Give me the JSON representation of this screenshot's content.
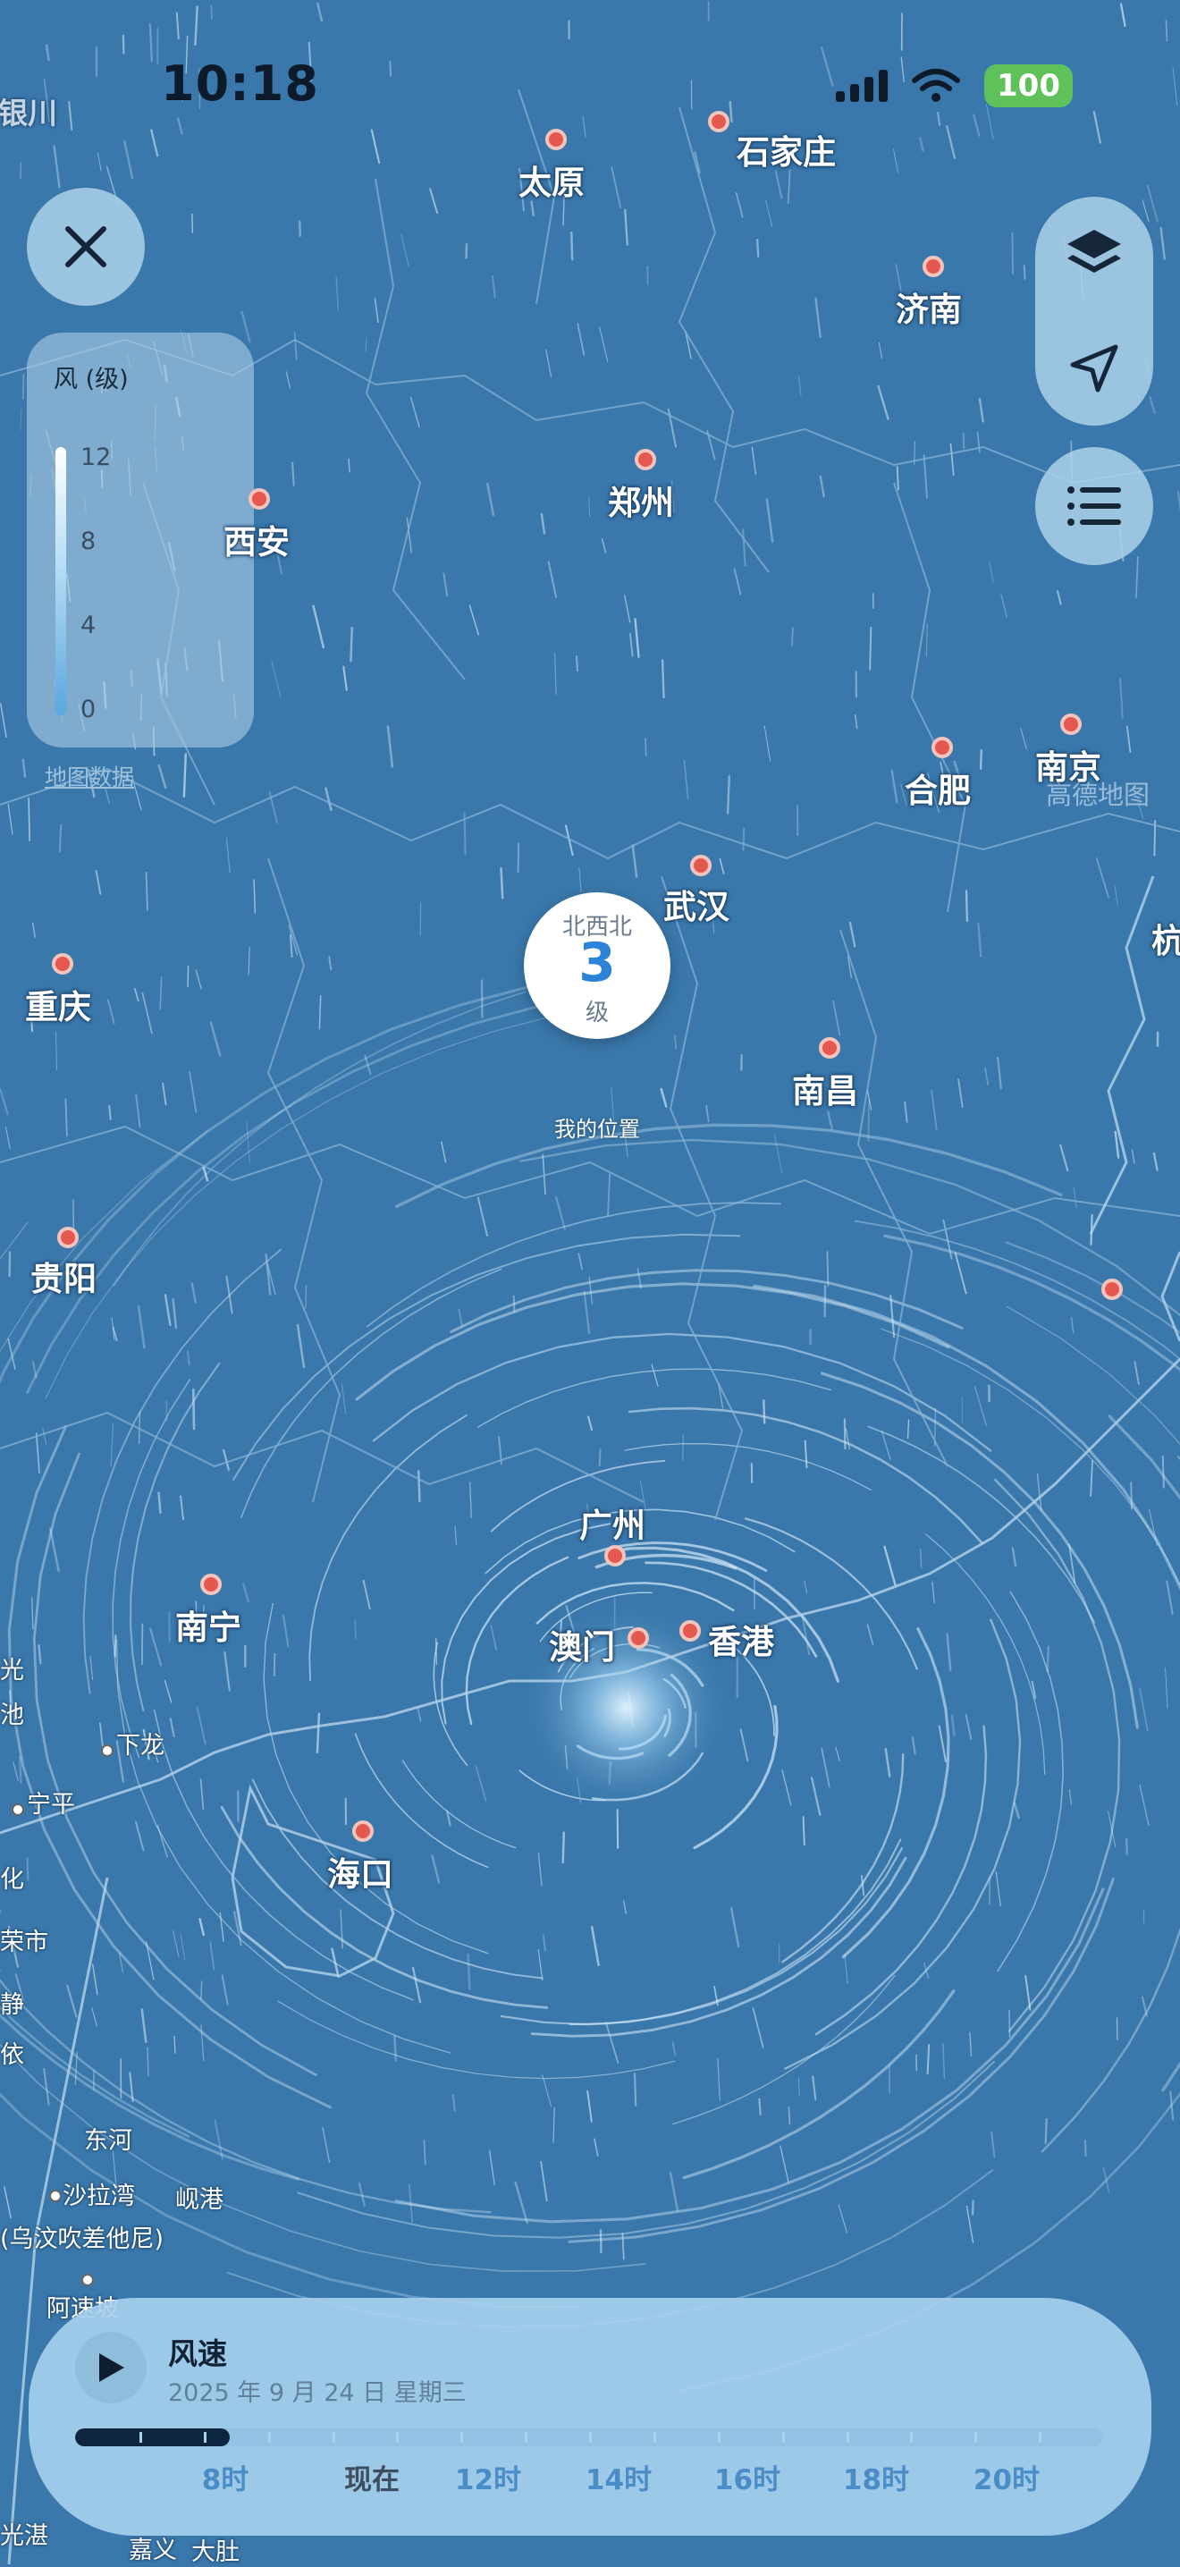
{
  "status_bar": {
    "time": "10:18",
    "battery": "100"
  },
  "legend": {
    "title": "风 (级)",
    "ticks": [
      "12",
      "8",
      "4",
      "0"
    ]
  },
  "map_data_link": "地图数据",
  "amap_logo": "高德地图",
  "location_marker": {
    "direction": "北西北",
    "level": "3",
    "unit": "级",
    "caption": "我的位置"
  },
  "cities": [
    "银川",
    "太原",
    "石家庄",
    "济南",
    "西安",
    "郑州",
    "合肥",
    "南京",
    "武汉",
    "杭",
    "重庆",
    "南昌",
    "贵阳",
    "广州",
    "南宁",
    "澳门",
    "香港",
    "海口"
  ],
  "towns": [
    "下龙",
    "宁平",
    "荣市",
    "东河",
    "沙拉湾",
    "岘港",
    "(乌汶吹差他尼)",
    "阿速坡",
    "嘉义",
    "大肚",
    "池",
    "化",
    "静",
    "依",
    "光",
    "光湛"
  ],
  "panel": {
    "title": "风速",
    "date": "2025 年 9 月 24 日 星期三",
    "progress": 0.15,
    "time_labels": [
      "8时",
      "现在",
      "12时",
      "14时",
      "16时",
      "18时",
      "20时"
    ]
  },
  "colors": {
    "ocean": "#3a78ab",
    "land": "#3674a8",
    "battery": "#5ec15a",
    "accent": "#2d83d8"
  }
}
